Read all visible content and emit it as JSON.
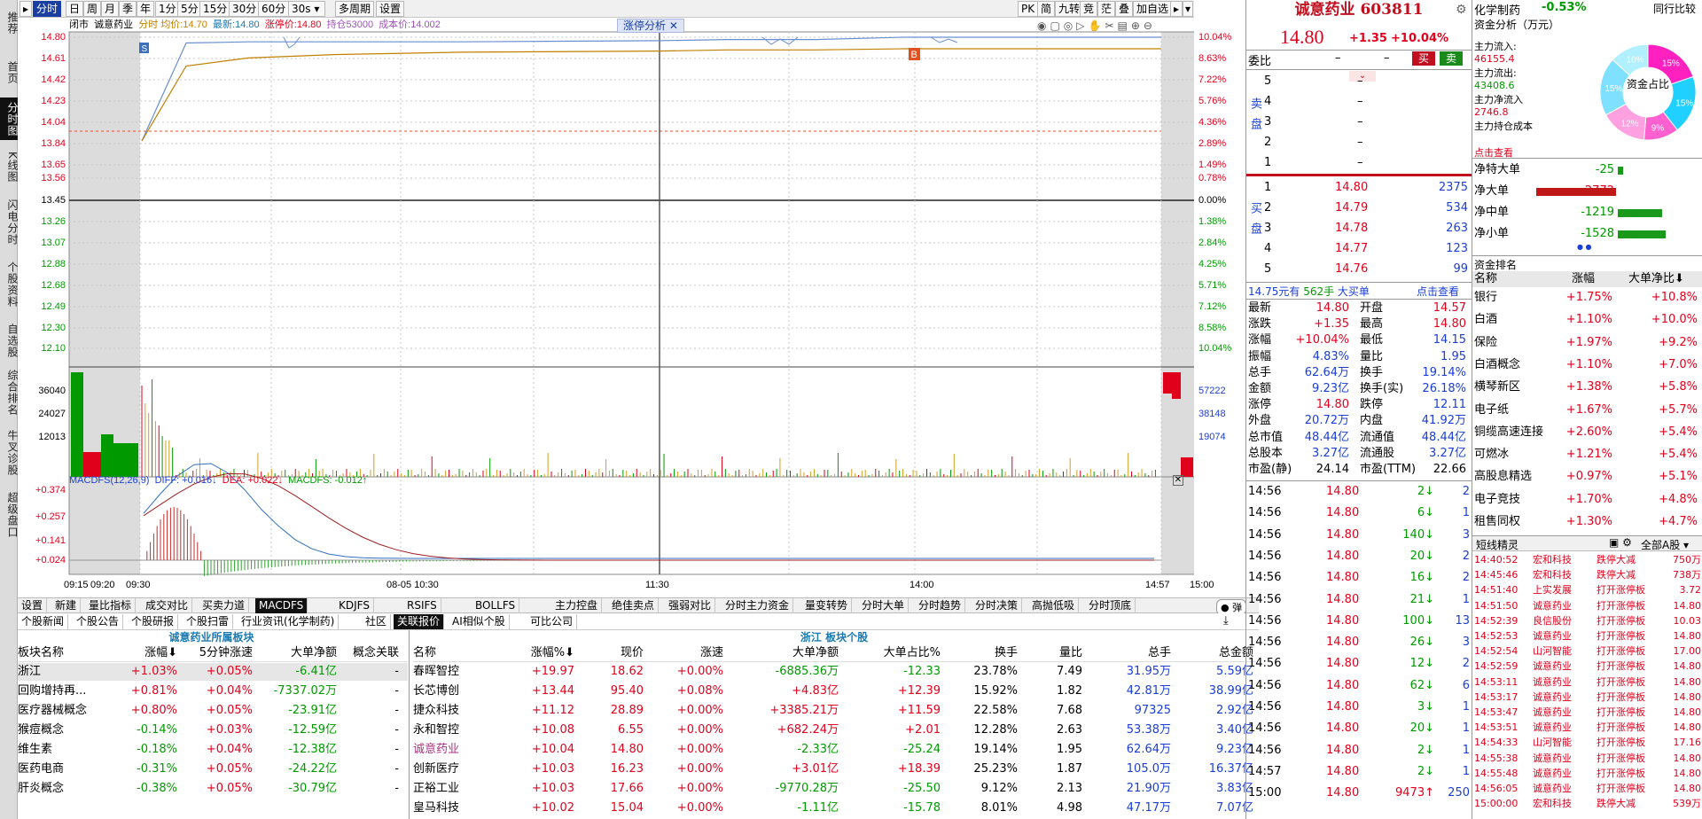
{
  "leftbar": [
    "推荐",
    "首页",
    "分时图",
    "K线图",
    "闪电分时",
    "个股资料",
    "自选股",
    "综合排名",
    "牛叉诊股",
    "超级盘口"
  ],
  "toolbar": {
    "periods": [
      "分时",
      "日",
      "周",
      "月",
      "季",
      "年",
      "1分",
      "5分",
      "15分",
      "30分",
      "60分",
      "30s",
      "多周期",
      "设置"
    ],
    "right_buttons": [
      "PK",
      "简",
      "九转",
      "竞",
      "茫",
      "叠",
      "加自选"
    ]
  },
  "chart": {
    "status": "闭市",
    "stock_name": "诚意药业",
    "legend": {
      "label": "分时",
      "avg_label": "均价:",
      "avg": "14.70",
      "latest_label": "最新:",
      "latest": "14.80",
      "limit_label": "涨停价:",
      "limit": "14.80",
      "hold_label": "持仓",
      "hold": "53000",
      "cost_label": "成本价:",
      "cost": "14.002"
    },
    "badge": "涨停分析",
    "price_ticks": [
      "14.80",
      "14.61",
      "14.42",
      "14.23",
      "14.04",
      "13.84",
      "13.65",
      "13.56",
      "13.45",
      "13.26",
      "13.07",
      "12.88",
      "12.68",
      "12.49",
      "12.30",
      "12.10"
    ],
    "pct_ticks": [
      "10.04%",
      "8.63%",
      "7.22%",
      "5.76%",
      "4.36%",
      "2.89%",
      "1.49%",
      "0.78%",
      "0.00%",
      "1.38%",
      "2.84%",
      "4.25%",
      "5.71%",
      "7.12%",
      "8.58%",
      "10.04%"
    ],
    "vol_ticks": [
      "36040",
      "24027",
      "12013"
    ],
    "vol_ticks_right": [
      "57222",
      "38148",
      "19074"
    ],
    "macd_ticks": [
      "+0.374",
      "+0.257",
      "+0.141",
      "+0.024"
    ],
    "macd_info": {
      "name": "MACDFS(12,26,9)",
      "diff": "DIFF: +0.016↓",
      "dea": "DEA: +0.022↓",
      "macdfs": "MACDFS: -0.012↑"
    },
    "time_labels": [
      "09:15",
      "09:20",
      "09:30",
      "08-05 10:30",
      "11:30",
      "14:00",
      "14:57",
      "15:00"
    ],
    "markers": [
      "S",
      "B"
    ],
    "chart_data": {
      "type": "line",
      "title": "",
      "x": [
        "09:30",
        "09:45",
        "10:00",
        "10:30",
        "11:00",
        "11:30",
        "13:00",
        "13:30",
        "14:00",
        "14:30",
        "14:57",
        "15:00"
      ],
      "series": [
        {
          "name": "分时",
          "values": [
            13.9,
            14.75,
            14.76,
            14.76,
            14.76,
            14.77,
            14.78,
            14.78,
            14.8,
            14.8,
            14.8,
            14.8
          ]
        },
        {
          "name": "均价",
          "values": [
            13.9,
            14.55,
            14.62,
            14.65,
            14.67,
            14.68,
            14.69,
            14.69,
            14.7,
            14.7,
            14.7,
            14.7
          ]
        }
      ],
      "ylim": [
        12.1,
        14.8
      ]
    }
  },
  "indicator_tabs": [
    "设置",
    "新建",
    "量比指标",
    "成交对比",
    "买卖力道",
    "MACDFS",
    "KDJFS",
    "RSIFS",
    "BOLLFS",
    "主力控盘",
    "绝佳卖点",
    "强弱对比",
    "分时主力资金",
    "量变转势",
    "分时大单",
    "分时趋势",
    "分时决策",
    "高抛低吸",
    "分时顶底"
  ],
  "info_tabs": [
    "个股新闻",
    "个股公告",
    "个股研报",
    "个股扫雷",
    "行业资讯(化学制药)",
    "社区",
    "关联报价",
    "AI相似个股",
    "可比公司"
  ],
  "sector": {
    "title": "诚意药业所属板块",
    "headers": [
      "板块名称",
      "涨幅",
      "5分钟涨速",
      "大单净额",
      "概念关联"
    ],
    "rows": [
      [
        "浙江",
        "+1.03%",
        "+0.05%",
        "-6.41亿",
        "-"
      ],
      [
        "回购增持再...",
        "+0.81%",
        "+0.04%",
        "-7337.02万",
        "-"
      ],
      [
        "医疗器械概念",
        "+0.80%",
        "+0.05%",
        "-23.91亿",
        "-"
      ],
      [
        "猴痘概念",
        "-0.14%",
        "+0.03%",
        "-12.59亿",
        "-"
      ],
      [
        "维生素",
        "-0.18%",
        "+0.04%",
        "-12.38亿",
        "-"
      ],
      [
        "医药电商",
        "-0.31%",
        "+0.05%",
        "-24.22亿",
        "-"
      ],
      [
        "肝炎概念",
        "-0.38%",
        "+0.05%",
        "-30.79亿",
        "-"
      ]
    ]
  },
  "stocks": {
    "title": "浙江 板块个股",
    "headers": [
      "名称",
      "涨幅%",
      "现价",
      "涨速",
      "大单净额",
      "大单占比%",
      "换手",
      "量比",
      "总手",
      "总金额"
    ],
    "rows": [
      [
        "春晖智控",
        "+19.97",
        "18.62",
        "+0.00%",
        "-6885.36万",
        "-12.33",
        "23.78%",
        "7.49",
        "31.95万",
        "5.59亿"
      ],
      [
        "长芯博创",
        "+13.44",
        "95.40",
        "+0.08%",
        "+4.83亿",
        "+12.39",
        "15.92%",
        "1.82",
        "42.81万",
        "38.99亿"
      ],
      [
        "捷众科技",
        "+11.12",
        "28.89",
        "+0.00%",
        "+3385.21万",
        "+11.59",
        "22.58%",
        "7.68",
        "97325",
        "2.92亿"
      ],
      [
        "永和智控",
        "+10.08",
        "6.55",
        "+0.00%",
        "+682.24万",
        "+2.01",
        "12.28%",
        "2.63",
        "53.38万",
        "3.40亿"
      ],
      [
        "诚意药业",
        "+10.04",
        "14.80",
        "+0.00%",
        "-2.33亿",
        "-25.24",
        "19.14%",
        "1.95",
        "62.64万",
        "9.23亿"
      ],
      [
        "创新医疗",
        "+10.03",
        "16.23",
        "+0.00%",
        "+3.01亿",
        "+18.39",
        "25.23%",
        "1.87",
        "105.0万",
        "16.37亿"
      ],
      [
        "正裕工业",
        "+10.03",
        "17.66",
        "+0.00%",
        "-9770.28万",
        "-25.50",
        "9.12%",
        "2.13",
        "21.90万",
        "3.83亿"
      ],
      [
        "皇马科技",
        "+10.02",
        "15.04",
        "+0.00%",
        "-1.11亿",
        "-15.78",
        "8.01%",
        "4.98",
        "47.17万",
        "7.07亿"
      ]
    ]
  },
  "quote": {
    "name": "诚意药业",
    "code": "603811",
    "price": "14.80",
    "change": "+1.35",
    "pct": "+10.04%",
    "weibi_label": "委比",
    "weibi": "–",
    "weicha": "–",
    "sell_label": "卖盘",
    "buy_label": "买盘",
    "sell_btn": "买",
    "buy_btn": "卖",
    "sell": [
      [
        "5",
        "–",
        ""
      ],
      [
        "4",
        "–",
        ""
      ],
      [
        "3",
        "–",
        ""
      ],
      [
        "2",
        "–",
        ""
      ],
      [
        "1",
        "–",
        ""
      ]
    ],
    "buy": [
      [
        "1",
        "14.80",
        "2375"
      ],
      [
        "2",
        "14.79",
        "534"
      ],
      [
        "3",
        "14.78",
        "263"
      ],
      [
        "4",
        "14.77",
        "123"
      ],
      [
        "5",
        "14.76",
        "99"
      ]
    ],
    "bigbuy": {
      "price": "14.75元有",
      "qty": "562手",
      "label": "大买单",
      "link": "点击查看"
    },
    "stats": [
      [
        "最新",
        "14.80",
        "开盘",
        "14.57"
      ],
      [
        "涨跌",
        "+1.35",
        "最高",
        "14.80"
      ],
      [
        "涨幅",
        "+10.04%",
        "最低",
        "14.15"
      ],
      [
        "振幅",
        "4.83%",
        "量比",
        "1.95"
      ],
      [
        "总手",
        "62.64万",
        "换手",
        "19.14%"
      ],
      [
        "金额",
        "9.23亿",
        "换手(实)",
        "26.18%"
      ],
      [
        "涨停",
        "14.80",
        "跌停",
        "12.11"
      ],
      [
        "外盘",
        "20.72万",
        "内盘",
        "41.92万"
      ],
      [
        "总市值",
        "48.44亿",
        "流通值",
        "48.44亿"
      ],
      [
        "总股本",
        "3.27亿",
        "流通股",
        "3.27亿"
      ],
      [
        "市盈(静)",
        "24.14",
        "市盈(TTM)",
        "22.66"
      ]
    ],
    "ticks": [
      [
        "14:56",
        "14.80",
        "2",
        "2"
      ],
      [
        "14:56",
        "14.80",
        "6",
        "1"
      ],
      [
        "14:56",
        "14.80",
        "140",
        "3"
      ],
      [
        "14:56",
        "14.80",
        "20",
        "2"
      ],
      [
        "14:56",
        "14.80",
        "16",
        "2"
      ],
      [
        "14:56",
        "14.80",
        "21",
        "1"
      ],
      [
        "14:56",
        "14.80",
        "100",
        "13"
      ],
      [
        "14:56",
        "14.80",
        "26",
        "3"
      ],
      [
        "14:56",
        "14.80",
        "12",
        "2"
      ],
      [
        "14:56",
        "14.80",
        "62",
        "6"
      ],
      [
        "14:56",
        "14.80",
        "3",
        "1"
      ],
      [
        "14:56",
        "14.80",
        "20",
        "1"
      ],
      [
        "14:56",
        "14.80",
        "2",
        "1"
      ],
      [
        "14:57",
        "14.80",
        "2",
        "1"
      ],
      [
        "15:00",
        "14.80",
        "9473",
        "250"
      ]
    ]
  },
  "far": {
    "title": "化学制药",
    "pct": "-0.53%",
    "compare": "同行比较",
    "fund_title": "资金分析（万元）",
    "fund": [
      [
        "主力流入:",
        "46155.4"
      ],
      [
        "主力流出:",
        "43408.6"
      ],
      [
        "主力净流入",
        "2746.8"
      ],
      [
        "主力持仓成本",
        ""
      ],
      [
        "点击查看",
        ""
      ]
    ],
    "donut_label": "资金占比",
    "donut_pcts": [
      "15%",
      "15%",
      "9%",
      "12%",
      "15%",
      "10%"
    ],
    "flows": [
      [
        "净特大单",
        "-25"
      ],
      [
        "净大单",
        "2772"
      ],
      [
        "净中单",
        "-1219"
      ],
      [
        "净小单",
        "-1528"
      ]
    ],
    "rank_title": "资金排名",
    "rank_headers": [
      "名称",
      "涨幅",
      "大单净比"
    ],
    "rank": [
      [
        "银行",
        "+1.75%",
        "+10.8%"
      ],
      [
        "白酒",
        "+1.10%",
        "+10.0%"
      ],
      [
        "保险",
        "+1.97%",
        "+9.2%"
      ],
      [
        "白酒概念",
        "+1.10%",
        "+7.0%"
      ],
      [
        "横琴新区",
        "+1.38%",
        "+5.8%"
      ],
      [
        "电子纸",
        "+1.67%",
        "+5.7%"
      ],
      [
        "铜缆高速连接",
        "+2.60%",
        "+5.4%"
      ],
      [
        "可燃冰",
        "+1.21%",
        "+5.4%"
      ],
      [
        "高股息精选",
        "+0.97%",
        "+5.1%"
      ],
      [
        "电子竞技",
        "+1.70%",
        "+4.8%"
      ],
      [
        "租售同权",
        "+1.30%",
        "+4.7%"
      ]
    ],
    "short_title": "短线精灵",
    "short_filter": "全部A股",
    "short": [
      [
        "14:40:52",
        "宏和科技",
        "跌停大减",
        "750万"
      ],
      [
        "14:45:46",
        "宏和科技",
        "跌停大减",
        "738万"
      ],
      [
        "14:51:40",
        "上实发展",
        "打开涨停板",
        "3.72"
      ],
      [
        "14:51:50",
        "诚意药业",
        "打开涨停板",
        "14.80"
      ],
      [
        "14:52:39",
        "良信股份",
        "打开涨停板",
        "10.03"
      ],
      [
        "14:52:53",
        "诚意药业",
        "打开涨停板",
        "14.80"
      ],
      [
        "14:52:54",
        "山河智能",
        "打开涨停板",
        "17.00"
      ],
      [
        "14:52:59",
        "诚意药业",
        "打开涨停板",
        "14.80"
      ],
      [
        "14:53:11",
        "诚意药业",
        "打开涨停板",
        "14.80"
      ],
      [
        "14:53:17",
        "诚意药业",
        "打开涨停板",
        "14.80"
      ],
      [
        "14:53:47",
        "诚意药业",
        "打开涨停板",
        "14.80"
      ],
      [
        "14:53:51",
        "诚意药业",
        "打开涨停板",
        "14.80"
      ],
      [
        "14:54:33",
        "山河智能",
        "打开涨停板",
        "17.16"
      ],
      [
        "14:55:38",
        "诚意药业",
        "打开涨停板",
        "14.80"
      ],
      [
        "14:55:48",
        "诚意药业",
        "打开涨停板",
        "14.80"
      ],
      [
        "14:56:05",
        "诚意药业",
        "打开涨停板",
        "14.80"
      ],
      [
        "15:00:00",
        "宏和科技",
        "跌停大减",
        "539万"
      ]
    ]
  }
}
